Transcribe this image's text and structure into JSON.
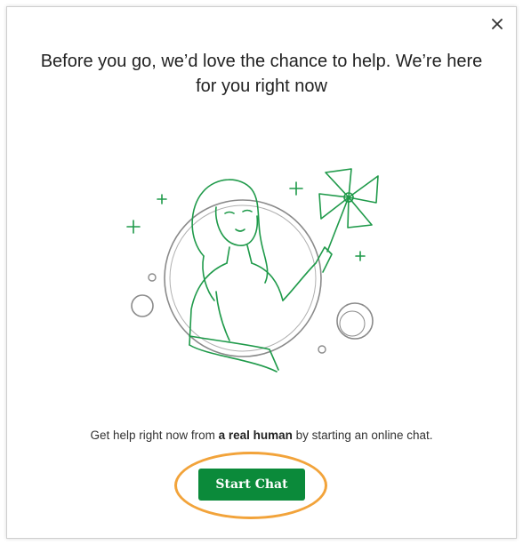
{
  "modal": {
    "heading": "Before you go, we’d love the chance to help. We’re here for you right now",
    "body_prefix": "Get help right now from ",
    "body_bold": "a real human",
    "body_suffix": " by starting an online chat.",
    "start_button_label": "Start Chat",
    "close_glyph": "×"
  },
  "colors": {
    "accent_green": "#0b8a3a",
    "illustration_green": "#1f9a4a",
    "ring_gray": "#8a8a8a",
    "highlight_orange": "#f2a33a"
  },
  "icons": {
    "close": "close-icon",
    "illustration": "woman-with-pinwheel-illustration"
  }
}
